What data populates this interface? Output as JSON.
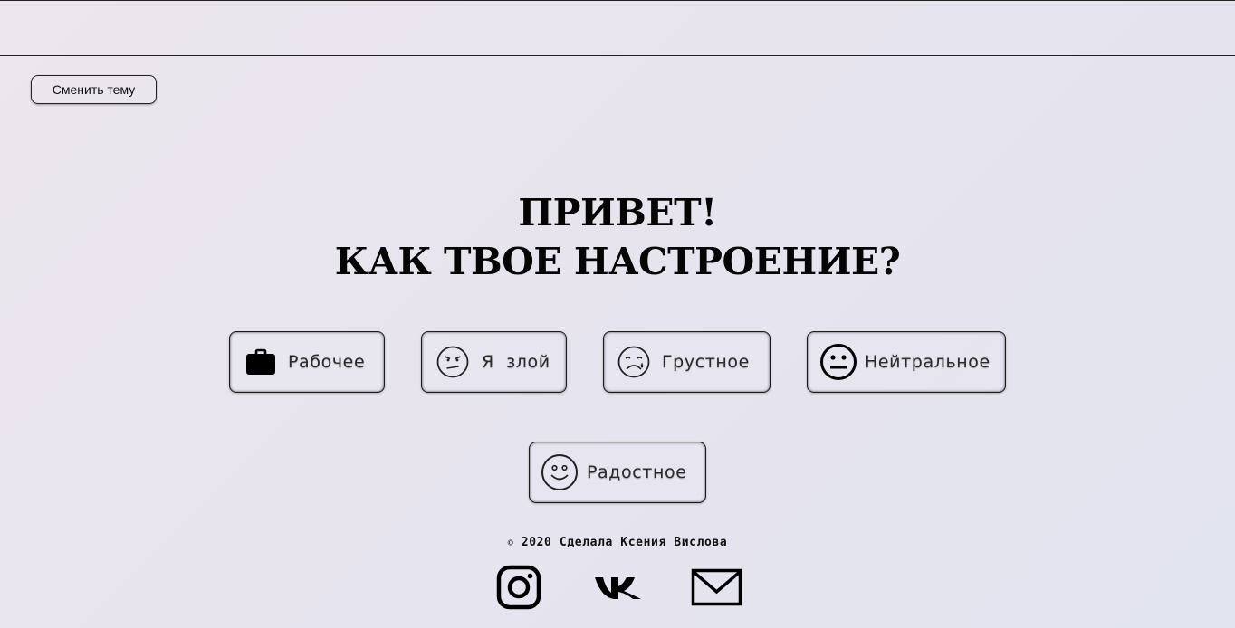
{
  "header": {
    "theme_button_label": "Сменить тему"
  },
  "greeting": {
    "line1": "ПРИВЕТ!",
    "line2": "КАК ТВОЕ НАСТРОЕНИЕ?"
  },
  "moods": [
    {
      "label": "Рабочее",
      "icon": "briefcase-icon"
    },
    {
      "label": "Я  злой",
      "icon": "angry-face-icon"
    },
    {
      "label": "Грустное",
      "icon": "sad-face-icon"
    },
    {
      "label": "Нейтральное",
      "icon": "neutral-face-icon"
    },
    {
      "label": "Радостное",
      "icon": "happy-face-icon"
    }
  ],
  "footer": {
    "copyright_symbol": "©",
    "text": "2020 Сделала Ксения Вислова",
    "socials": [
      "instagram-icon",
      "vk-icon",
      "mail-icon"
    ]
  }
}
